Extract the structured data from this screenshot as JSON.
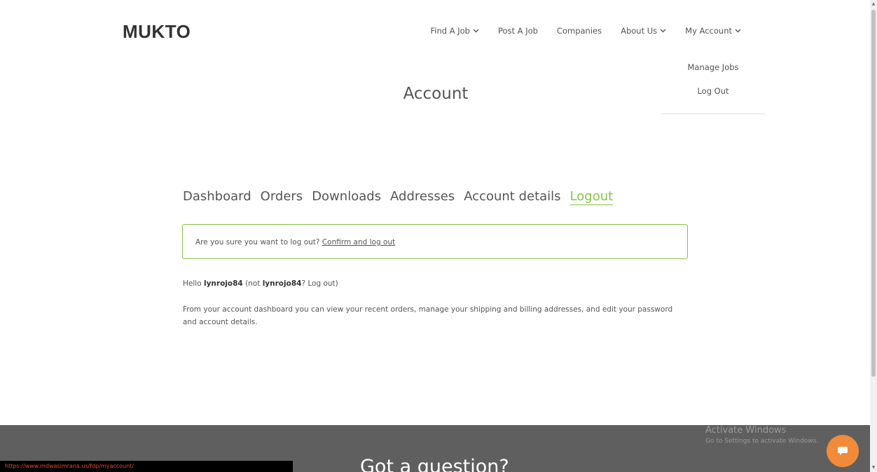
{
  "brand": {
    "logo": "MUKTO"
  },
  "nav": {
    "items": [
      {
        "label": "Find A Job",
        "dropdown": true
      },
      {
        "label": "Post A Job",
        "dropdown": false
      },
      {
        "label": "Companies",
        "dropdown": false
      },
      {
        "label": "About Us",
        "dropdown": true
      },
      {
        "label": "My Account",
        "dropdown": true
      }
    ],
    "account_menu": [
      "Manage Jobs",
      "Log Out"
    ]
  },
  "page": {
    "title": "Account"
  },
  "account_tabs": [
    "Dashboard",
    "Orders",
    "Downloads",
    "Addresses",
    "Account details",
    "Logout"
  ],
  "active_tab": "Logout",
  "notice": {
    "message": "Are you sure you want to log out?",
    "link": "Confirm and log out"
  },
  "greeting": {
    "prefix": "Hello",
    "user": "lynrojo84",
    "middle": "(not",
    "user2": "lynrojo84",
    "suffix": "? Log out)"
  },
  "description": "From your account dashboard you can view your recent orders, manage your shipping and billing addresses, and edit your password and account details.",
  "footer": {
    "heading": "Got a question?"
  },
  "status_bar": {
    "url": "https://www.mdwasimrana.us/fdp/myaccount/"
  },
  "windows_overlay": {
    "title": "Activate Windows",
    "subtitle": "Go to Settings to activate Windows."
  },
  "colors": {
    "accent": "#8ac245",
    "footer_bg": "#5f5f5f",
    "chat_button": "#f18b3a"
  }
}
